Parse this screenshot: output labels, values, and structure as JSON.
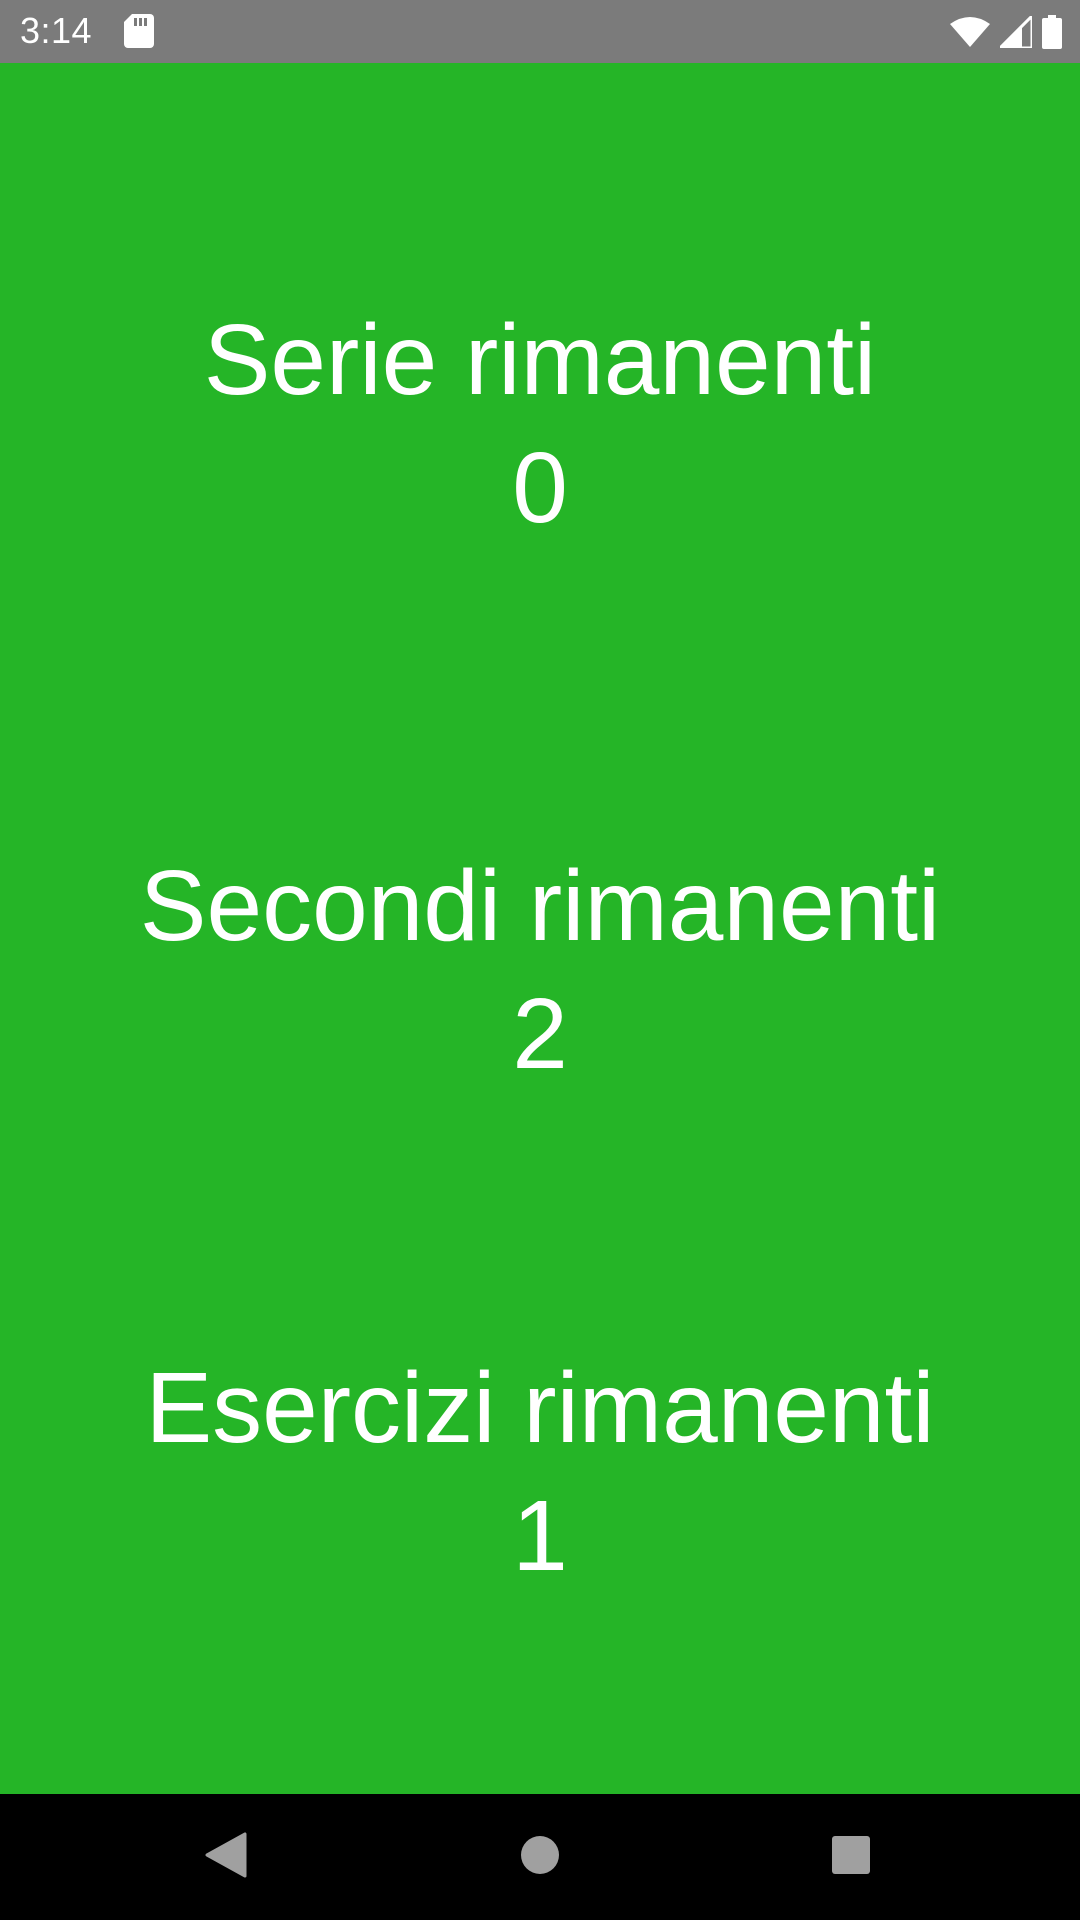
{
  "status_bar": {
    "time": "3:14",
    "icons": [
      "sd-card-icon",
      "wifi-icon",
      "signal-icon",
      "battery-icon"
    ]
  },
  "main": {
    "series": {
      "label": "Serie rimanenti",
      "value": "0"
    },
    "seconds": {
      "label": "Secondi rimanenti",
      "value": "2"
    },
    "exercises": {
      "label": "Esercizi rimanenti",
      "value": "1"
    }
  },
  "nav_bar": {
    "icons": [
      "back-icon",
      "home-icon",
      "recents-icon"
    ]
  },
  "colors": {
    "background": "#25b527",
    "status_bar": "#7b7b7b",
    "nav_bar": "#000000",
    "text": "#ffffff"
  }
}
